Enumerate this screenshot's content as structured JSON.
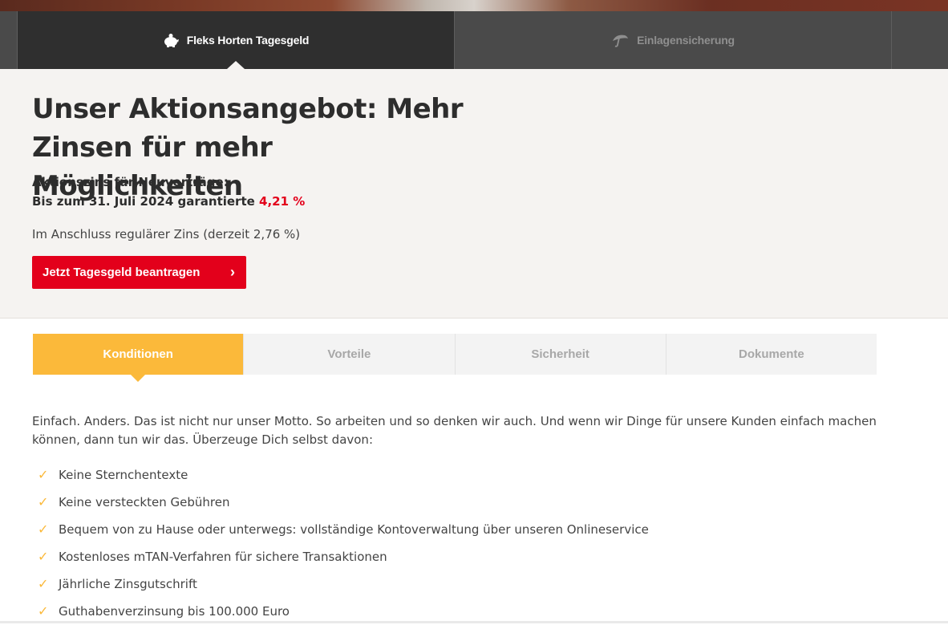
{
  "top_nav": {
    "tabs": [
      {
        "label": "Fleks Horten Tagesgeld",
        "icon": "piggy-bank-icon",
        "active": true
      },
      {
        "label": "Einlagensicherung",
        "icon": "umbrella-icon",
        "active": false
      }
    ]
  },
  "offer": {
    "title": "Unser Aktionsangebot: Mehr Zinsen für mehr Möglichkeiten",
    "promo_label": "Aktionszins für Neuverträge:",
    "promo_line_prefix": "Bis zum 31. Juli 2024 garantierte ",
    "promo_rate": "4,21 %",
    "regular_rate_text": "Im Anschluss regulärer Zins (derzeit 2,76 %)",
    "cta_label": "Jetzt Tagesgeld beantragen",
    "cta_icon": "chevron-right-icon"
  },
  "subtabs": [
    {
      "label": "Konditionen",
      "active": true
    },
    {
      "label": "Vorteile",
      "active": false
    },
    {
      "label": "Sicherheit",
      "active": false
    },
    {
      "label": "Dokumente",
      "active": false
    }
  ],
  "content": {
    "intro": "Einfach. Anders. Das ist nicht nur unser Motto. So arbeiten und so denken wir auch. Und wenn wir Dinge für unsere Kunden einfach machen können, dann tun wir das. Überzeuge Dich selbst davon:",
    "list_icon": "checkmark-icon",
    "items": [
      "Keine Sternchentexte",
      "Keine versteckten Gebühren",
      "Bequem von zu Hause oder unterwegs: vollständige Kontoverwaltung über unseren Onlineservice",
      "Kostenloses mTAN-Verfahren für sichere Transaktionen",
      "Jährliche Zinsgutschrift",
      "Guthabenverzinsung bis 100.000 Euro"
    ]
  },
  "colors": {
    "brand_red": "#e3001b",
    "accent_yellow": "#fbb93a",
    "nav_dark": "#2f2f2f",
    "nav_gray": "#4a4a4a"
  }
}
